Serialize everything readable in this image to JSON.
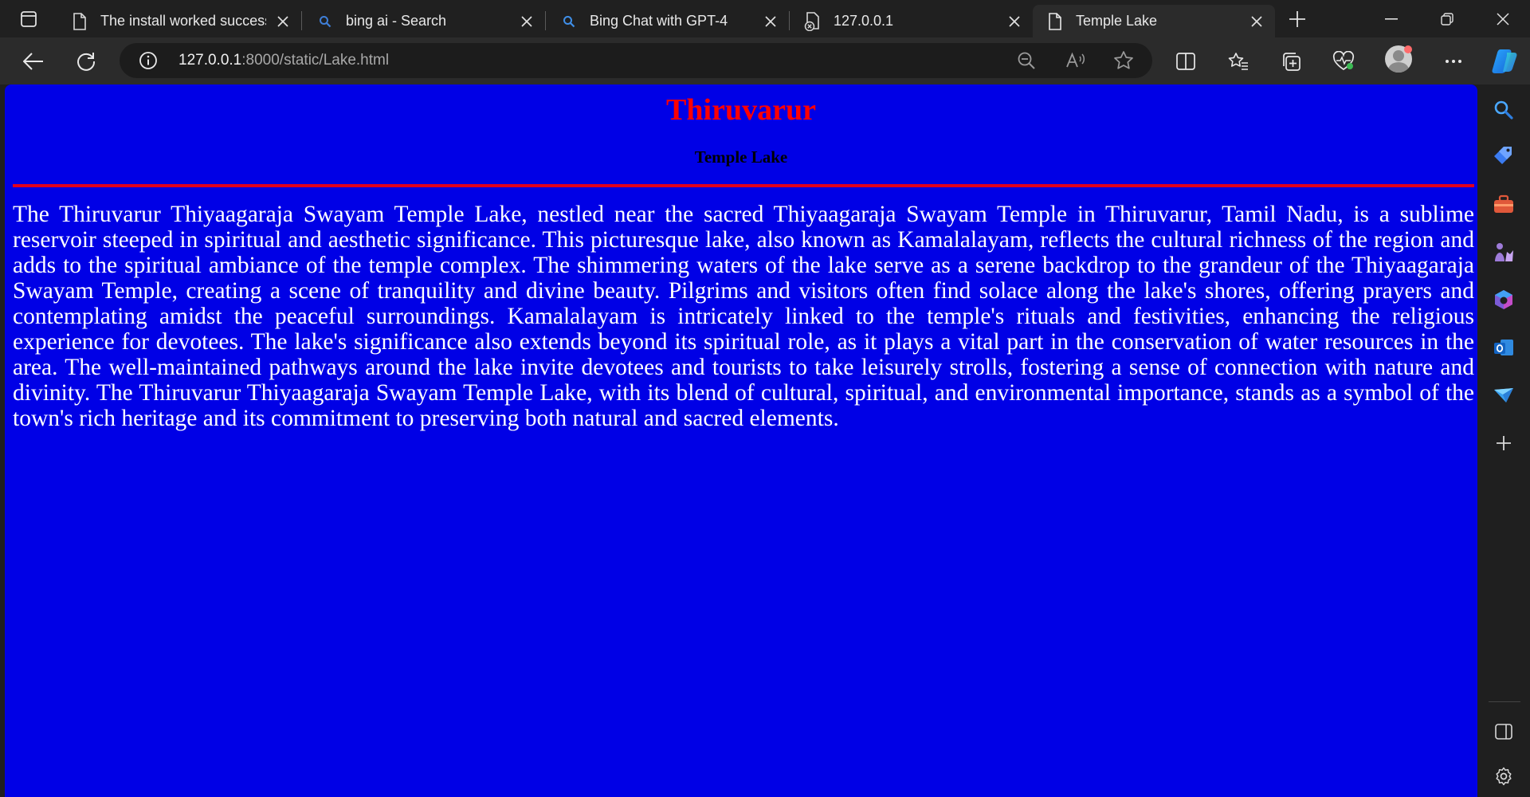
{
  "tabs": [
    {
      "title": "The install worked successfully! Congratulations!",
      "icon": "page-icon",
      "active": false
    },
    {
      "title": "bing ai - Search",
      "icon": "search-icon",
      "active": false
    },
    {
      "title": "Bing Chat with GPT-4",
      "icon": "search-icon",
      "active": false
    },
    {
      "title": "127.0.0.1",
      "icon": "blocked-page-icon",
      "active": false
    },
    {
      "title": "Temple Lake",
      "icon": "page-icon",
      "active": true
    }
  ],
  "address": {
    "host": "127.0.0.1",
    "rest": ":8000/static/Lake.html"
  },
  "page": {
    "heading": "Thiruvarur",
    "subheading": "Temple Lake",
    "body": "The Thiruvarur Thiyaagaraja Swayam Temple Lake, nestled near the sacred Thiyaagaraja Swayam Temple in Thiruvarur, Tamil Nadu, is a sublime reservoir steeped in spiritual and aesthetic significance. This picturesque lake, also known as Kamalalayam, reflects the cultural richness of the region and adds to the spiritual ambiance of the temple complex. The shimmering waters of the lake serve as a serene backdrop to the grandeur of the Thiyaagaraja Swayam Temple, creating a scene of tranquility and divine beauty. Pilgrims and visitors often find solace along the lake's shores, offering prayers and contemplating amidst the peaceful surroundings. Kamalalayam is intricately linked to the temple's rituals and festivities, enhancing the religious experience for devotees. The lake's significance also extends beyond its spiritual role, as it plays a vital part in the conservation of water resources in the area. The well-maintained pathways around the lake invite devotees and tourists to take leisurely strolls, fostering a sense of connection with nature and divinity. The Thiruvarur Thiyaagaraja Swayam Temple Lake, with its blend of cultural, spiritual, and environmental importance, stands as a symbol of the town's rich heritage and its commitment to preserving both natural and sacred elements.",
    "colors": {
      "background": "#0000e6",
      "heading": "#ff0000",
      "subheading": "#000000",
      "rule": "#e00020",
      "text": "#ffffff"
    }
  },
  "toolbar_icons": [
    "back-icon",
    "refresh-icon",
    "info-icon",
    "zoom-out-icon",
    "read-aloud-icon",
    "favorite-star-icon",
    "split-screen-icon",
    "favorites-icon",
    "collections-icon",
    "browser-essentials-icon",
    "profile-avatar",
    "more-icon",
    "copilot-icon"
  ],
  "sidebar_icons": [
    "search-icon",
    "shopping-tag-icon",
    "tools-icon",
    "games-icon",
    "microsoft365-icon",
    "outlook-icon",
    "drop-icon",
    "add-icon",
    "hide-sidebar-icon",
    "settings-icon"
  ]
}
